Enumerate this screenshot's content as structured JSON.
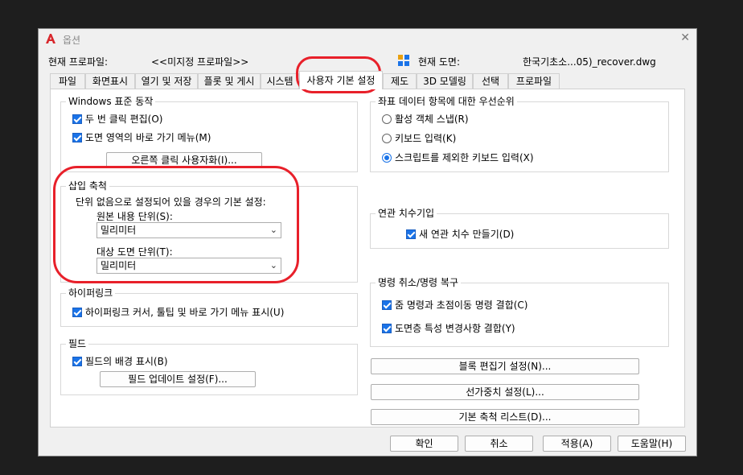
{
  "dialog": {
    "title": "옵션",
    "close_glyph": "✕",
    "current_profile_label": "현재 프로파일:",
    "current_profile_value": "<<미지정 프로파일>>",
    "current_drawing_label": "현재 도면:",
    "current_drawing_value": "한국기초소...05)_recover.dwg"
  },
  "tabs": [
    {
      "label": "파일"
    },
    {
      "label": "화면표시"
    },
    {
      "label": "열기 및 저장"
    },
    {
      "label": "플롯 및 게시"
    },
    {
      "label": "시스템"
    },
    {
      "label": "사용자 기본 설정"
    },
    {
      "label": "제도"
    },
    {
      "label": "3D 모델링"
    },
    {
      "label": "선택"
    },
    {
      "label": "프로파일"
    }
  ],
  "windows": {
    "title": "Windows 표준 동작",
    "double_click": "두 번 클릭 편집(O)",
    "shortcut_menu": "도면 영역의 바로 가기 메뉴(M)",
    "right_click_button": "오른쪽 클릭 사용자화(I)..."
  },
  "insert_scale": {
    "title": "삽입 축척",
    "desc": "단위 없음으로 설정되어 있을 경우의 기본 설정:",
    "source_label": "원본 내용 단위(S):",
    "source_value": "밀리미터",
    "target_label": "대상 도면 단위(T):",
    "target_value": "밀리미터"
  },
  "hyperlink": {
    "title": "하이퍼링크",
    "option": "하이퍼링크 커서, 툴팁 및 바로 가기 메뉴 표시(U)"
  },
  "field": {
    "title": "필드",
    "background": "필드의 배경 표시(B)",
    "update_button": "필드 업데이트 설정(F)..."
  },
  "coord_priority": {
    "title": "좌표 데이터 항목에 대한 우선순위",
    "opt1": "활성 객체 스냅(R)",
    "opt2": "키보드 입력(K)",
    "opt3": "스크립트를 제외한 키보드 입력(X)"
  },
  "assoc_dim": {
    "title": "연관 치수기입",
    "option": "새 연관 치수 만들기(D)"
  },
  "undo_redo": {
    "title": "명령 취소/명령 복구",
    "zoom_pan": "줌 명령과 초점이동 명령 결합(C)",
    "layer_props": "도면층 특성 변경사항 결합(Y)"
  },
  "right_buttons": {
    "block_editor": "블록 편집기 설정(N)...",
    "lineweight": "선가중치 설정(L)...",
    "scale_list": "기본 축척 리스트(D)..."
  },
  "footer": {
    "ok": "확인",
    "cancel": "취소",
    "apply": "적용(A)",
    "help": "도움말(H)"
  },
  "colors": {
    "accent": "#1a73e8",
    "annotation_red": "#e8202a",
    "logo_red": "#d8262b"
  }
}
